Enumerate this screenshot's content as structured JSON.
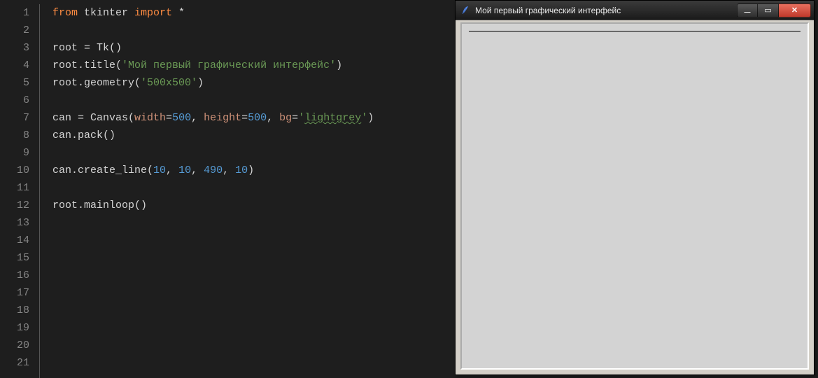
{
  "gutter": [
    "1",
    "2",
    "3",
    "4",
    "5",
    "6",
    "7",
    "8",
    "9",
    "10",
    "11",
    "12",
    "13",
    "14",
    "15",
    "16",
    "17",
    "18",
    "19",
    "20",
    "21"
  ],
  "code": {
    "lines": [
      {
        "type": "code",
        "tokens": [
          {
            "cls": "tk-kw",
            "t": "from"
          },
          {
            "cls": "tk-def",
            "t": " tkinter "
          },
          {
            "cls": "tk-kw",
            "t": "import"
          },
          {
            "cls": "tk-def",
            "t": " *"
          }
        ]
      },
      {
        "type": "blank"
      },
      {
        "type": "code",
        "tokens": [
          {
            "cls": "tk-def",
            "t": "root = Tk()"
          }
        ]
      },
      {
        "type": "code",
        "tokens": [
          {
            "cls": "tk-def",
            "t": "root.title("
          },
          {
            "cls": "tk-str",
            "t": "'Мой первый графический интерфейс'"
          },
          {
            "cls": "tk-def",
            "t": ")"
          }
        ]
      },
      {
        "type": "code",
        "tokens": [
          {
            "cls": "tk-def",
            "t": "root.geometry("
          },
          {
            "cls": "tk-str",
            "t": "'500x500'"
          },
          {
            "cls": "tk-def",
            "t": ")"
          }
        ]
      },
      {
        "type": "blank"
      },
      {
        "type": "code",
        "tokens": [
          {
            "cls": "tk-def",
            "t": "can = Canvas("
          },
          {
            "cls": "tk-param",
            "t": "width"
          },
          {
            "cls": "tk-op",
            "t": "="
          },
          {
            "cls": "tk-num",
            "t": "500"
          },
          {
            "cls": "tk-def",
            "t": ", "
          },
          {
            "cls": "tk-param",
            "t": "height"
          },
          {
            "cls": "tk-op",
            "t": "="
          },
          {
            "cls": "tk-num",
            "t": "500"
          },
          {
            "cls": "tk-def",
            "t": ", "
          },
          {
            "cls": "tk-param",
            "t": "bg"
          },
          {
            "cls": "tk-op",
            "t": "="
          },
          {
            "cls": "tk-str",
            "t": "'"
          },
          {
            "cls": "tk-strul",
            "t": "lightgrey"
          },
          {
            "cls": "tk-str",
            "t": "'"
          },
          {
            "cls": "tk-def",
            "t": ")"
          }
        ]
      },
      {
        "type": "code",
        "tokens": [
          {
            "cls": "tk-def",
            "t": "can.pack()"
          }
        ]
      },
      {
        "type": "blank"
      },
      {
        "type": "code",
        "tokens": [
          {
            "cls": "tk-def",
            "t": "can.create_line("
          },
          {
            "cls": "tk-num",
            "t": "10"
          },
          {
            "cls": "tk-def",
            "t": ", "
          },
          {
            "cls": "tk-num",
            "t": "10"
          },
          {
            "cls": "tk-def",
            "t": ", "
          },
          {
            "cls": "tk-num",
            "t": "490"
          },
          {
            "cls": "tk-def",
            "t": ", "
          },
          {
            "cls": "tk-num",
            "t": "10"
          },
          {
            "cls": "tk-def",
            "t": ")"
          }
        ]
      },
      {
        "type": "blank"
      },
      {
        "type": "code",
        "tokens": [
          {
            "cls": "tk-def",
            "t": "root.mainloop()"
          }
        ]
      },
      {
        "type": "blank"
      },
      {
        "type": "blank"
      },
      {
        "type": "blank"
      },
      {
        "type": "blank"
      },
      {
        "type": "blank"
      },
      {
        "type": "blank"
      },
      {
        "type": "blank"
      },
      {
        "type": "blank"
      },
      {
        "type": "blank"
      }
    ]
  },
  "window": {
    "title": "Мой первый графический интерфейс",
    "buttons": {
      "minimize_glyph": "—",
      "maximize_glyph": "▭",
      "close_glyph": "✕"
    }
  }
}
